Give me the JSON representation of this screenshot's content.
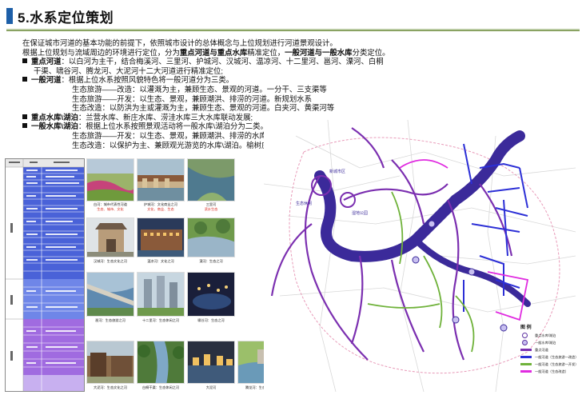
{
  "title": "5.水系定位策划",
  "intro": {
    "line1": "在保证城市河道的基本功能的前提下，依照城市设计的总体概念与上位规划进行河道景观设计。",
    "line2_a": "根据上位规划与流域周边的环境进行定位，分为",
    "line2_b": "重点河道与重点水库",
    "line2_c": "精准定位，",
    "line2_d": "一般河道与一般水库",
    "line2_e": "分类定位。"
  },
  "key_rivers": {
    "label": "重点河道",
    "text1": "：以白河为主干，结合梅溪河、三里河、护城河、汉城河、温凉河、十二里河、邕河、溧河、白桐",
    "text2": "干渠、啸谷河、腾龙河、大泥河十二大河道进行精准定位;"
  },
  "general_rivers": {
    "label": "一般河道",
    "text": "：根据上位水系按照风貌特色将一般河道分为三类。",
    "items": [
      "生态旅游——改造：以灌溉为主，兼顾生态、景观的河道。一分干、三支渠等",
      "生态旅游——开发：以生态、景观，兼顾潮洪、排涝的河道。新规划水系",
      "生态改造：以防洪为主或灌溉为主，兼顾生态、景观的河道。白夹河、黄渠河等"
    ]
  },
  "key_reservoirs": {
    "label": "重点水库\\湖泊",
    "text": "：兰营水库、新庄水库、涝洼水库三大水库联动发展;"
  },
  "general_reservoirs": {
    "label": "一般水库\\湖泊",
    "text": "：根据上位水系按照景观活动将一般水库\\湖泊分为二类。",
    "items": [
      "生态旅游——开发：以生态、景观，兼顾潮洪、排涝的水库\\湖泊。如玉湖、如意湖",
      "生态改造：以保护为主、兼顾观光游览的水库\\湖泊。榆树庄水库。"
    ]
  },
  "photo_captions": {
    "p1": "白河：城市代表性河道",
    "p2": "护城河：文化商业之河",
    "p3": "三里河",
    "p1r": "生态、城市、文化",
    "p2r": "文化、商业、生态",
    "p3r": "滨水生态",
    "p4": "汉城河：生态文化之河",
    "p5": "温凉河：文化之河",
    "p6": "十二里河：休闲商业之河",
    "p7": "溧河：生态之河",
    "p8": "邕河：生态旅游之河",
    "p9": "十二里河：生态休闲之河",
    "p10": "啸谷河：生态之河",
    "p11": "梅溪河",
    "p12": "大泥河：生态文化之河",
    "p13": "白桐干渠：生态休闲之河",
    "p14": "大泥河",
    "p15": "腾龙河：生态科普之河",
    "p16": "一般河道",
    "p17": "一般水库"
  },
  "map_labels": {
    "l1": "新城市区",
    "l2": "生态休闲",
    "l3": "湿地公园"
  },
  "legend": {
    "title": "图 例",
    "items": [
      {
        "label": "重点水库\\湖泊",
        "kind": "circle"
      },
      {
        "label": "一般水库\\湖泊",
        "kind": "circle"
      },
      {
        "label": "重点河道",
        "kind": "line",
        "color": "#7b2fb0"
      },
      {
        "label": "一般河道（生态旅游—改造）",
        "kind": "line",
        "color": "#2c2fd6"
      },
      {
        "label": "一般河道（生态旅游—开发）",
        "kind": "line",
        "color": "#6fb23a"
      },
      {
        "label": "一般河道（生态改造）",
        "kind": "line",
        "color": "#e02be0"
      }
    ]
  },
  "colors": {
    "river_main": "#3b2a9a",
    "key_river": "#7b2fb0",
    "general_blue": "#2c2fd6",
    "general_green": "#6fb23a",
    "general_magenta": "#e02be0"
  }
}
